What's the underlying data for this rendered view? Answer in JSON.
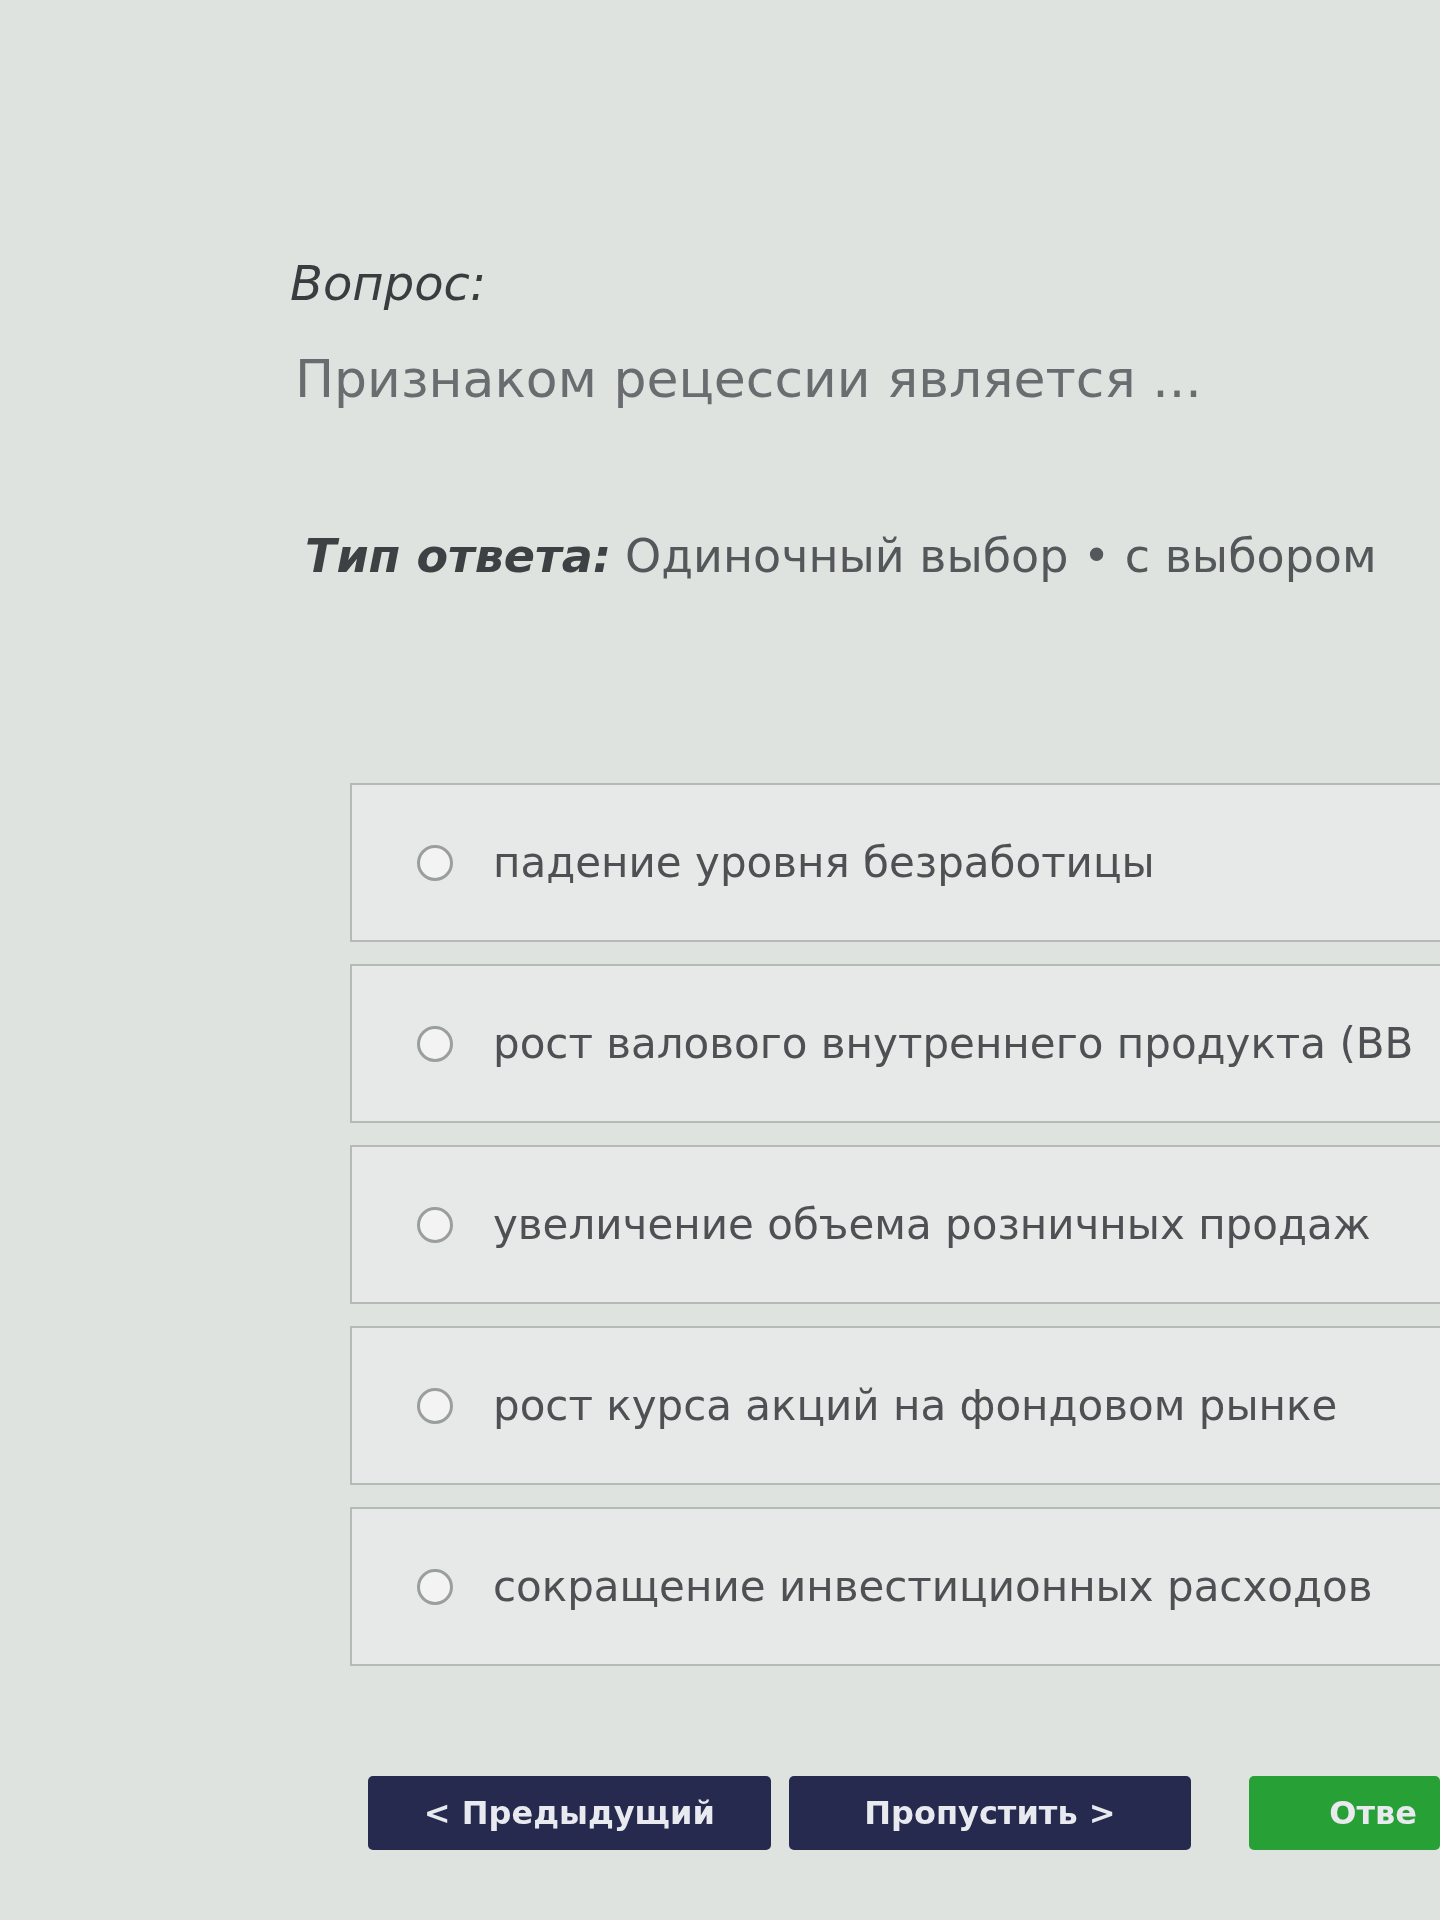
{
  "question": {
    "heading": "Вопрос:",
    "text": "Признаком рецессии является ..."
  },
  "answer_type": {
    "label": "Тип ответа:",
    "value": "Одиночный выбор • с выбором"
  },
  "options": [
    {
      "label": "падение уровня безработицы",
      "selected": false
    },
    {
      "label": "рост валового внутреннего продукта (ВВ",
      "selected": false
    },
    {
      "label": "увеличение объема розничных продаж",
      "selected": false
    },
    {
      "label": "рост курса акций на фондовом рынке",
      "selected": false
    },
    {
      "label": "сокращение инвестиционных расходов",
      "selected": false
    }
  ],
  "buttons": [
    {
      "label": "< Предыдущий",
      "kind": "nav"
    },
    {
      "label": "Пропустить >",
      "kind": "nav"
    },
    {
      "label": "Отве",
      "kind": "submit"
    }
  ]
}
